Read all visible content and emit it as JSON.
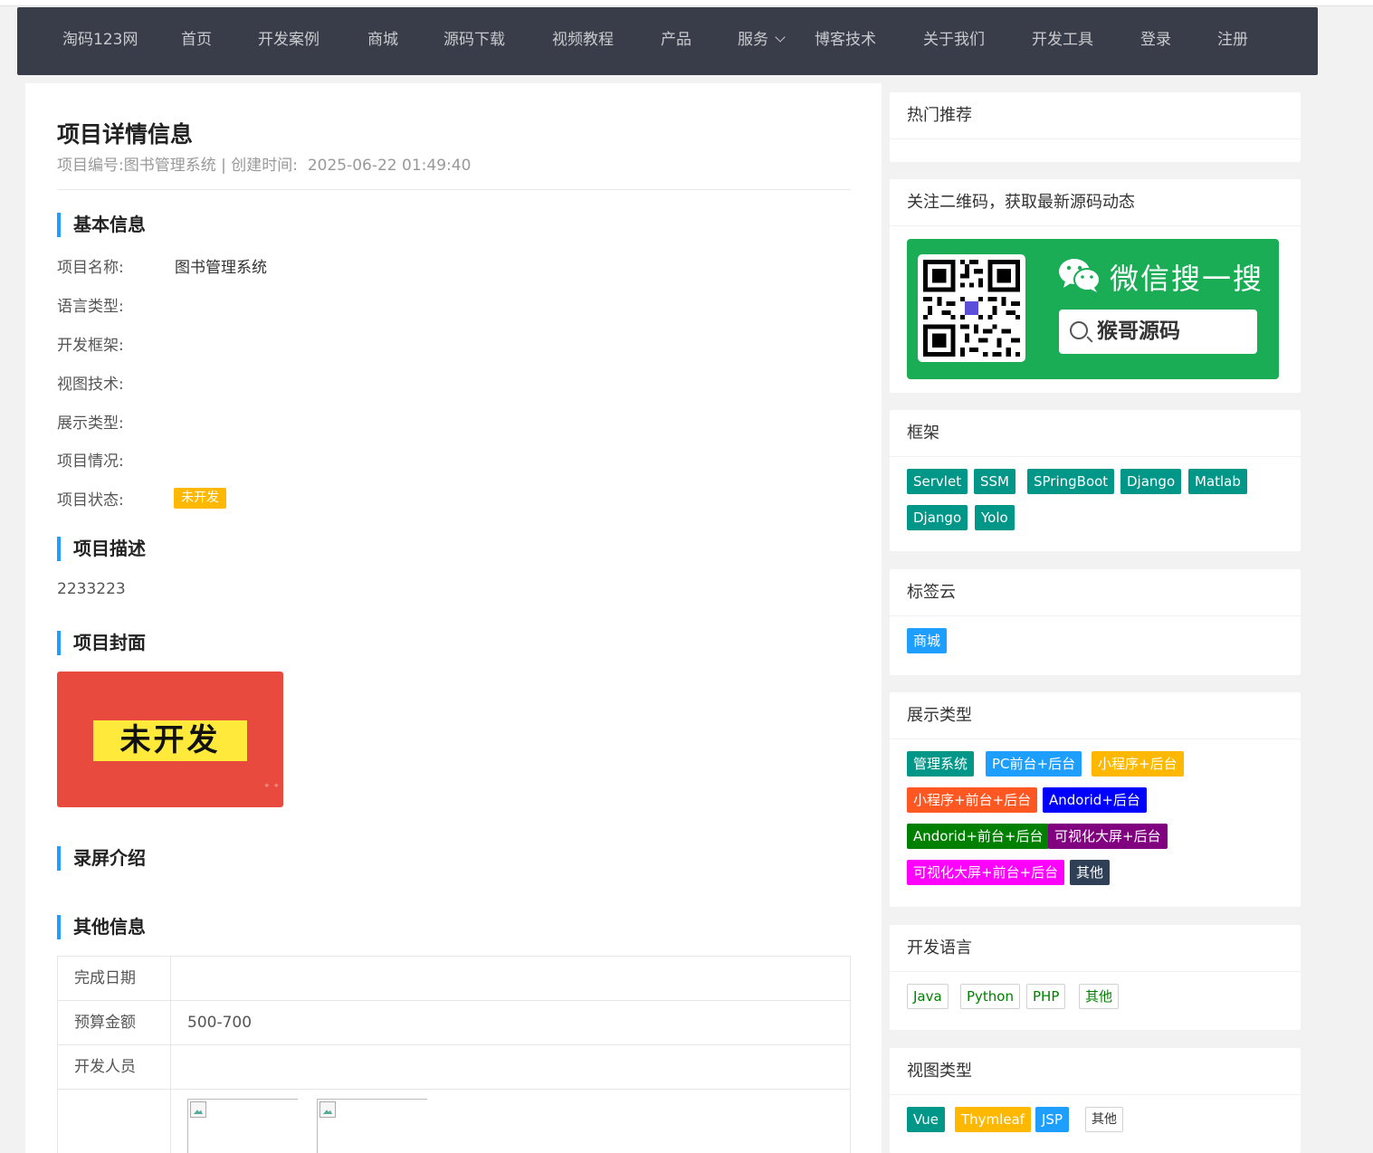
{
  "nav": {
    "items": [
      "淘码123网",
      "首页",
      "开发案例",
      "商城",
      "源码下载",
      "视频教程",
      "产品",
      "服务",
      "博客技术",
      "关于我们",
      "开发工具",
      "登录",
      "注册"
    ]
  },
  "project": {
    "title": "项目详情信息",
    "meta_no_label": "项目编号:",
    "meta_no": "图书管理系统",
    "meta_sep": "|",
    "meta_time_label": "创建时间:",
    "meta_time": "2025-06-22 01:49:40"
  },
  "basic": {
    "heading": "基本信息",
    "rows": [
      {
        "label": "项目名称:",
        "value": "图书管理系统"
      },
      {
        "label": "语言类型:",
        "value": ""
      },
      {
        "label": "开发框架:",
        "value": ""
      },
      {
        "label": "视图技术:",
        "value": ""
      },
      {
        "label": "展示类型:",
        "value": ""
      },
      {
        "label": "项目情况:",
        "value": ""
      },
      {
        "label": "项目状态:",
        "value": ""
      }
    ],
    "status_badge": "未开发",
    "status_color": "#ffb800"
  },
  "description": {
    "heading": "项目描述",
    "text": "2233223"
  },
  "cover": {
    "heading": "项目封面",
    "text": "未开发"
  },
  "recording": {
    "heading": "录屏介绍"
  },
  "other": {
    "heading": "其他信息",
    "rows": [
      {
        "label": "完成日期",
        "value": ""
      },
      {
        "label": "预算金额",
        "value": "500-700"
      },
      {
        "label": "开发人员",
        "value": ""
      }
    ]
  },
  "sidebar": {
    "hot": {
      "title": "热门推荐"
    },
    "qr": {
      "title": "关注二维码，获取最新源码动态",
      "wechat_text": "微信搜一搜",
      "search_text": "猴哥源码"
    },
    "framework": {
      "title": "框架",
      "tags": [
        "Servlet",
        "SSM",
        "SPringBoot",
        "Django",
        "Matlab",
        "Django",
        "Yolo"
      ],
      "color": "#009688"
    },
    "tagcloud": {
      "title": "标签云",
      "tags": [
        "商城"
      ],
      "color": "#1e9fff"
    },
    "display": {
      "title": "展示类型",
      "tags": [
        {
          "label": "管理系统",
          "color": "#009688"
        },
        {
          "label": "PC前台+后台",
          "color": "#1e9fff"
        },
        {
          "label": "小程序+后台",
          "color": "#ffb800"
        },
        {
          "label": "小程序+前台+后台",
          "color": "#ff5722"
        },
        {
          "label": "Andorid+后台",
          "color": "#0000ff"
        },
        {
          "label": "Andorid+前台+后台",
          "color": "#008000"
        },
        {
          "label": "可视化大屏+后台",
          "color": "#800080"
        },
        {
          "label": "可视化大屏+前台+后台",
          "color": "#ff00ff"
        },
        {
          "label": "其他",
          "color": "#2f4056"
        }
      ]
    },
    "language": {
      "title": "开发语言",
      "tags": [
        "Java",
        "Python",
        "PHP",
        "其他"
      ],
      "color": "#008000"
    },
    "view": {
      "title": "视图类型",
      "tags": [
        {
          "label": "Vue",
          "color": "#009688"
        },
        {
          "label": "Thymleaf",
          "color": "#ffb800"
        },
        {
          "label": "JSP",
          "color": "#1e9fff"
        }
      ],
      "other": "其他"
    }
  }
}
